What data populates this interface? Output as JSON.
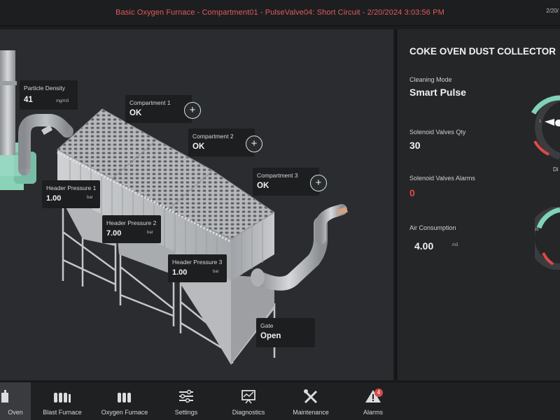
{
  "header": {
    "alarm_message": "Basic Oxygen Furnace - Compartment01 - PulseValve04: Short Circuit - 2/20/2024 3:03:56 PM",
    "date_short": "2/20/"
  },
  "diagram": {
    "particle_density": {
      "label": "Particle Density",
      "value": "41",
      "unit": "mg/m3"
    },
    "compartments": [
      {
        "label": "Compartment 1",
        "value": "OK"
      },
      {
        "label": "Compartment 2",
        "value": "OK"
      },
      {
        "label": "Compartment 3",
        "value": "OK"
      }
    ],
    "header_pressures": [
      {
        "label": "Header Pressure 1",
        "value": "1.00",
        "unit": "bar"
      },
      {
        "label": "Header Pressure 2",
        "value": "7.00",
        "unit": "bar"
      },
      {
        "label": "Header Pressure 3",
        "value": "1.00",
        "unit": "bar"
      }
    ],
    "gate": {
      "label": "Gate",
      "value": "Open"
    }
  },
  "right_panel": {
    "title": "COKE OVEN DUST COLLECTOR",
    "cleaning_mode": {
      "label": "Cleaning Mode",
      "value": "Smart Pulse"
    },
    "solenoid_qty": {
      "label": "Solenoid Valves Qty",
      "value": "30"
    },
    "solenoid_alarms": {
      "label": "Solenoid Valves Alarms",
      "value": "0"
    },
    "air_consumption": {
      "label": "Air Consumption",
      "value": "4.00",
      "unit": "m3"
    },
    "gauge_labels": {
      "g1_tick": "1",
      "g1_caption": "Di",
      "g2_tick": "20"
    },
    "colors": {
      "accent": "#7fd3b6",
      "alarm": "#e04848"
    }
  },
  "nav": {
    "items": [
      {
        "label": "Oven",
        "icon": "coke-oven-icon",
        "active": true
      },
      {
        "label": "Blast Furnace",
        "icon": "blast-furnace-icon"
      },
      {
        "label": "Oxygen Furnace",
        "icon": "oxygen-furnace-icon"
      },
      {
        "label": "Settings",
        "icon": "settings-sliders-icon"
      },
      {
        "label": "Diagnostics",
        "icon": "diagnostics-icon"
      },
      {
        "label": "Maintenance",
        "icon": "maintenance-tools-icon"
      },
      {
        "label": "Alarms",
        "icon": "alarm-warning-icon",
        "badge": "4"
      }
    ]
  }
}
